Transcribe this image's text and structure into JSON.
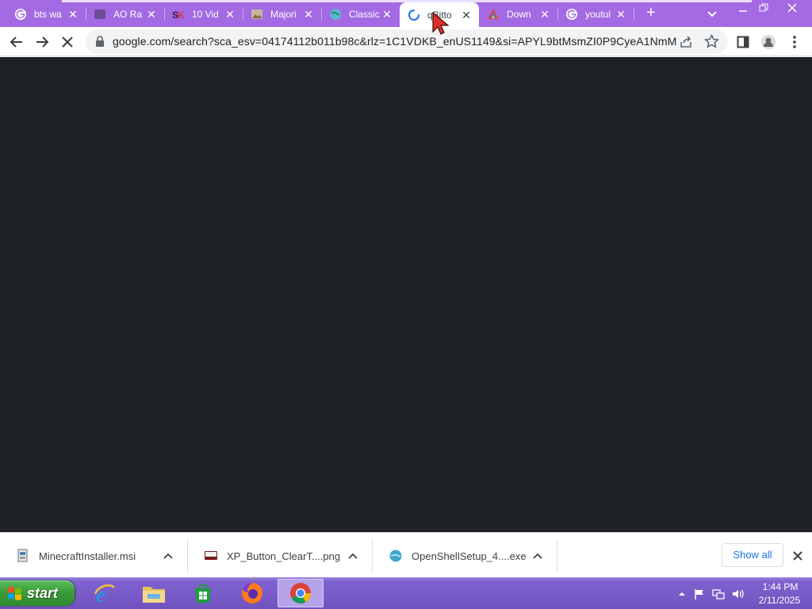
{
  "browser": {
    "tabs": [
      {
        "title": "bts wa",
        "favicon": "google-g-icon"
      },
      {
        "title": "AO Ra",
        "favicon": "dark-square-icon"
      },
      {
        "title": "10 Vid",
        "favicon": "sk-logo-icon"
      },
      {
        "title": "Majori",
        "favicon": "image-thumb-icon"
      },
      {
        "title": "Classic",
        "favicon": "globe-icon"
      },
      {
        "title": "qBitto",
        "favicon": "loading-spinner-icon",
        "active": true
      },
      {
        "title": "Down",
        "favicon": "colorful-logo-icon"
      },
      {
        "title": "youtul",
        "favicon": "google-g-icon"
      }
    ],
    "address_bar": {
      "url": "google.com/search?sca_esv=04174112b011b98c&rlz=1C1VDKB_enUS1149&si=APYL9btMsmZI0P9CyeA1NmMZ..."
    },
    "theme_color": "#a36ae3",
    "page_background": "#1f2326"
  },
  "downloads": {
    "items": [
      {
        "name": "MinecraftInstaller.msi",
        "icon": "msi-installer-icon"
      },
      {
        "name": "XP_Button_ClearT....png",
        "icon": "image-file-icon"
      },
      {
        "name": "OpenShellSetup_4....exe",
        "icon": "shell-setup-icon"
      }
    ],
    "show_all_label": "Show all"
  },
  "taskbar": {
    "start_label": "start",
    "pinned": [
      {
        "name": "internet-explorer-icon"
      },
      {
        "name": "file-explorer-icon"
      },
      {
        "name": "microsoft-store-icon"
      },
      {
        "name": "firefox-icon"
      },
      {
        "name": "chrome-icon",
        "active": true
      }
    ],
    "clock_time": "1:44 PM",
    "clock_date": "2/11/2025"
  }
}
